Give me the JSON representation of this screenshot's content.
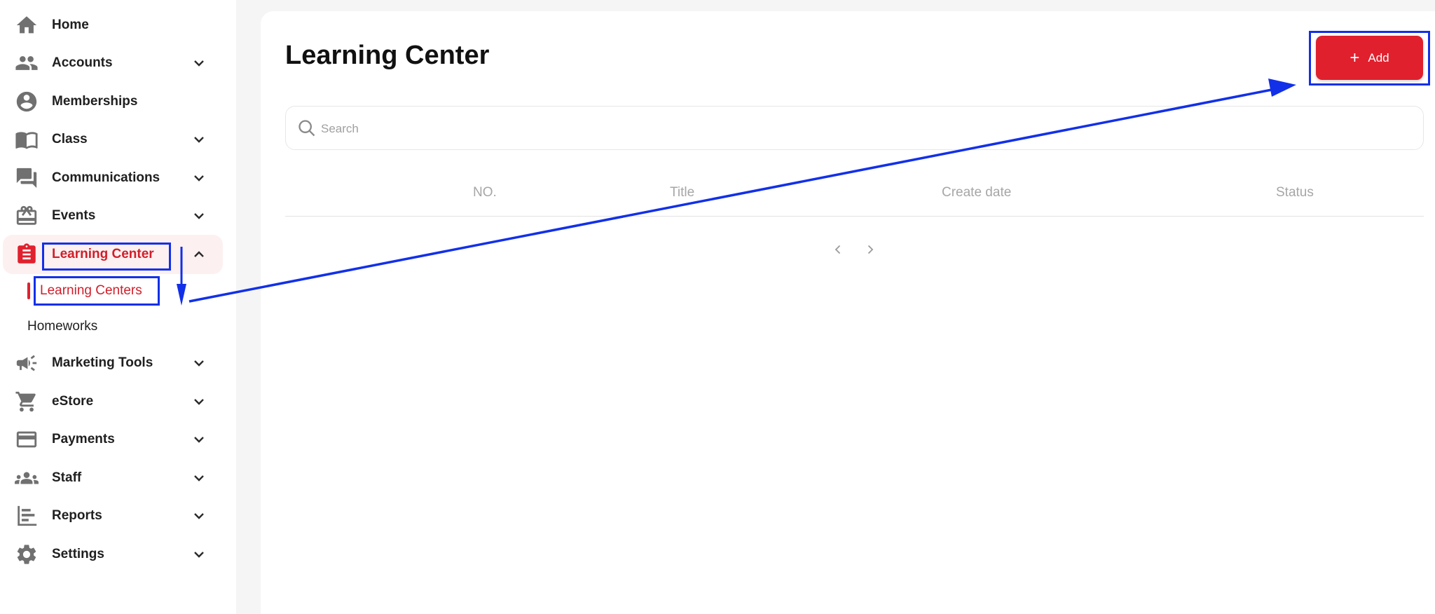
{
  "sidebar": {
    "items": [
      {
        "label": "Home",
        "icon": "home-icon",
        "has_chevron": false
      },
      {
        "label": "Accounts",
        "icon": "people-icon",
        "has_chevron": true
      },
      {
        "label": "Memberships",
        "icon": "account-circle-icon",
        "has_chevron": false
      },
      {
        "label": "Class",
        "icon": "book-icon",
        "has_chevron": true
      },
      {
        "label": "Communications",
        "icon": "chat-icon",
        "has_chevron": true
      },
      {
        "label": "Events",
        "icon": "gift-card-icon",
        "has_chevron": true
      },
      {
        "label": "Learning Center",
        "icon": "clipboard-icon",
        "has_chevron": true,
        "expanded": true,
        "active": true
      },
      {
        "label": "Marketing Tools",
        "icon": "megaphone-icon",
        "has_chevron": true
      },
      {
        "label": "eStore",
        "icon": "cart-icon",
        "has_chevron": true
      },
      {
        "label": "Payments",
        "icon": "credit-card-icon",
        "has_chevron": true
      },
      {
        "label": "Staff",
        "icon": "groups-icon",
        "has_chevron": true
      },
      {
        "label": "Reports",
        "icon": "bar-chart-icon",
        "has_chevron": true
      },
      {
        "label": "Settings",
        "icon": "gear-icon",
        "has_chevron": true
      }
    ],
    "subitems": [
      {
        "label": "Learning Centers",
        "active": true
      },
      {
        "label": "Homeworks",
        "active": false
      }
    ]
  },
  "main": {
    "title": "Learning Center",
    "add_button": {
      "label": "Add",
      "icon": "plus-icon"
    },
    "search": {
      "placeholder": "Search",
      "value": "",
      "icon": "search-icon"
    },
    "table": {
      "columns": [
        "NO.",
        "Title",
        "Create date",
        "Status"
      ],
      "rows": []
    },
    "pagination": {
      "prev_icon": "chevron-left-icon",
      "next_icon": "chevron-right-icon"
    }
  },
  "colors": {
    "accent": "#e0202d",
    "active_bg": "#fdf0f0",
    "annotation": "#1230e8",
    "icon_gray": "#707070"
  }
}
